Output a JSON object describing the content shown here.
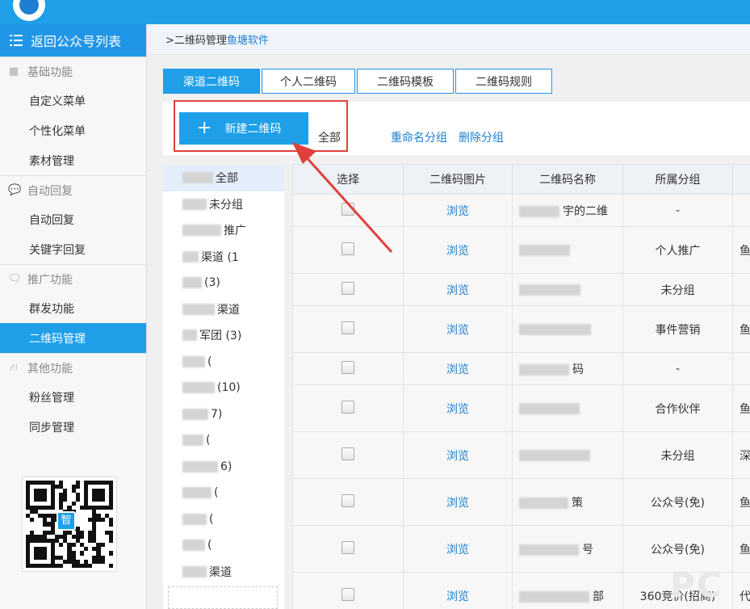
{
  "app": {
    "title": "",
    "subtitle": ""
  },
  "sidebar": {
    "back_label": "返回公众号列表",
    "groups": [
      {
        "title": "基础功能",
        "icon": "grid-icon",
        "items": [
          "自定义菜单",
          "个性化菜单",
          "素材管理"
        ]
      },
      {
        "title": "自动回复",
        "icon": "chat-bubble-icon",
        "items": [
          "自动回复",
          "关键字回复"
        ]
      },
      {
        "title": "推广功能",
        "icon": "chat-bubbles-icon",
        "items": [
          "群发功能",
          "二维码管理"
        ]
      },
      {
        "title": "其他功能",
        "icon": "hierarchy-icon",
        "items": [
          "粉丝管理",
          "同步管理"
        ]
      }
    ],
    "active_item": "二维码管理",
    "qr_center_label": "智"
  },
  "breadcrumb": {
    "prefix": ">二维码管理",
    "link": "鱼塘软件"
  },
  "tabs": [
    "渠道二维码",
    "个人二维码",
    "二维码模板",
    "二维码规则"
  ],
  "active_tab": "渠道二维码",
  "toolbar": {
    "new_button": "新建二维码",
    "new_button_icon": "plus-icon",
    "current_group": "全部",
    "rename_group": "重命名分组",
    "delete_group": "删除分组"
  },
  "group_list": [
    "全部",
    "未分组",
    "推广",
    "渠道 (1",
    "(3)",
    "渠道",
    "军团 (3)",
    "(",
    "(10)",
    "7)",
    "(",
    "6)",
    "(",
    "(",
    "(",
    "渠道"
  ],
  "table": {
    "headers": [
      "选择",
      "二维码图片",
      "二维码名称",
      "所属分组",
      ""
    ],
    "rows": [
      {
        "image": "浏览",
        "name": "宇的二维",
        "group": "-",
        "extra": ""
      },
      {
        "image": "浏览",
        "name": "",
        "group": "个人推广",
        "extra": "鱼"
      },
      {
        "image": "浏览",
        "name": "",
        "group": "未分组",
        "extra": ""
      },
      {
        "image": "浏览",
        "name": "",
        "group": "事件营销",
        "extra": "鱼"
      },
      {
        "image": "浏览",
        "name": "码",
        "group": "-",
        "extra": ""
      },
      {
        "image": "浏览",
        "name": "",
        "group": "合作伙伴",
        "extra": "鱼"
      },
      {
        "image": "浏览",
        "name": "",
        "group": "未分组",
        "extra": "深"
      },
      {
        "image": "浏览",
        "name": "策",
        "group": "公众号(免)",
        "extra": "鱼"
      },
      {
        "image": "浏览",
        "name": "号",
        "group": "公众号(免)",
        "extra": "鱼"
      },
      {
        "image": "浏览",
        "name": "部",
        "group": "360竞价(招商)",
        "extra": "代"
      }
    ]
  },
  "colors": {
    "primary": "#1e9fe8",
    "link": "#1e7fd0",
    "highlight_red": "#e0403b"
  }
}
